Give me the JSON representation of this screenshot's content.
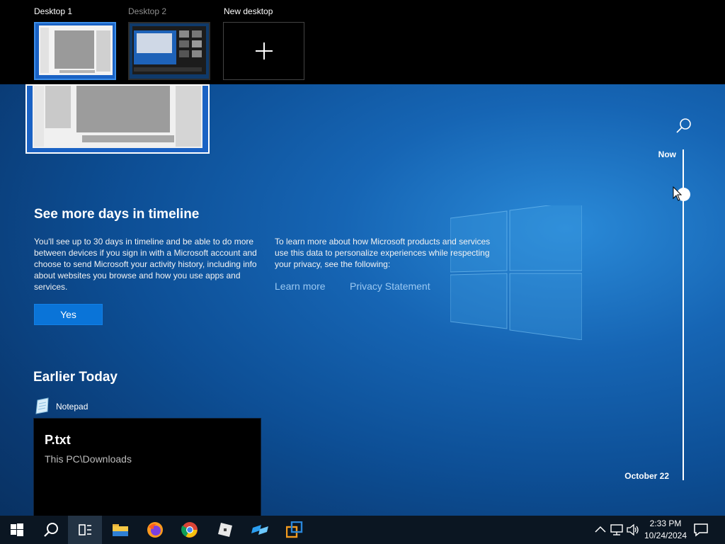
{
  "desktops": {
    "items": [
      {
        "label": "Desktop 1"
      },
      {
        "label": "Desktop 2"
      }
    ],
    "new_label": "New desktop"
  },
  "timeline": {
    "now_label": "Now",
    "date_label": "October 22"
  },
  "promo": {
    "title": "See more days in timeline",
    "left_text": "You'll see up to 30 days in timeline and be able to do more between devices if you sign in with a Microsoft account and choose to send Microsoft your activity history, including info about websites you browse and how you use apps and services.",
    "right_text": "To learn more about how Microsoft products and services use this data to personalize experiences while respecting your privacy, see the following:",
    "learn_more": "Learn more",
    "privacy": "Privacy Statement",
    "yes_label": "Yes"
  },
  "earlier": {
    "title": "Earlier Today",
    "app_name": "Notepad",
    "card_title": "P.txt",
    "card_subtitle": "This PC\\Downloads"
  },
  "taskbar": {
    "apps": [
      "start-icon",
      "search-icon",
      "task-view-icon",
      "file-explorer-icon",
      "firefox-icon",
      "chrome-icon",
      "roblox-icon",
      "roblox-studio-icon",
      "virtualbox-icon"
    ],
    "time": "2:33 PM",
    "date": "10/24/2024"
  },
  "colors": {
    "accent": "#0a74d8",
    "active_desktop_border": "#3c8ee8",
    "link": "#9ac8f2",
    "taskbar": "#0b1622"
  }
}
